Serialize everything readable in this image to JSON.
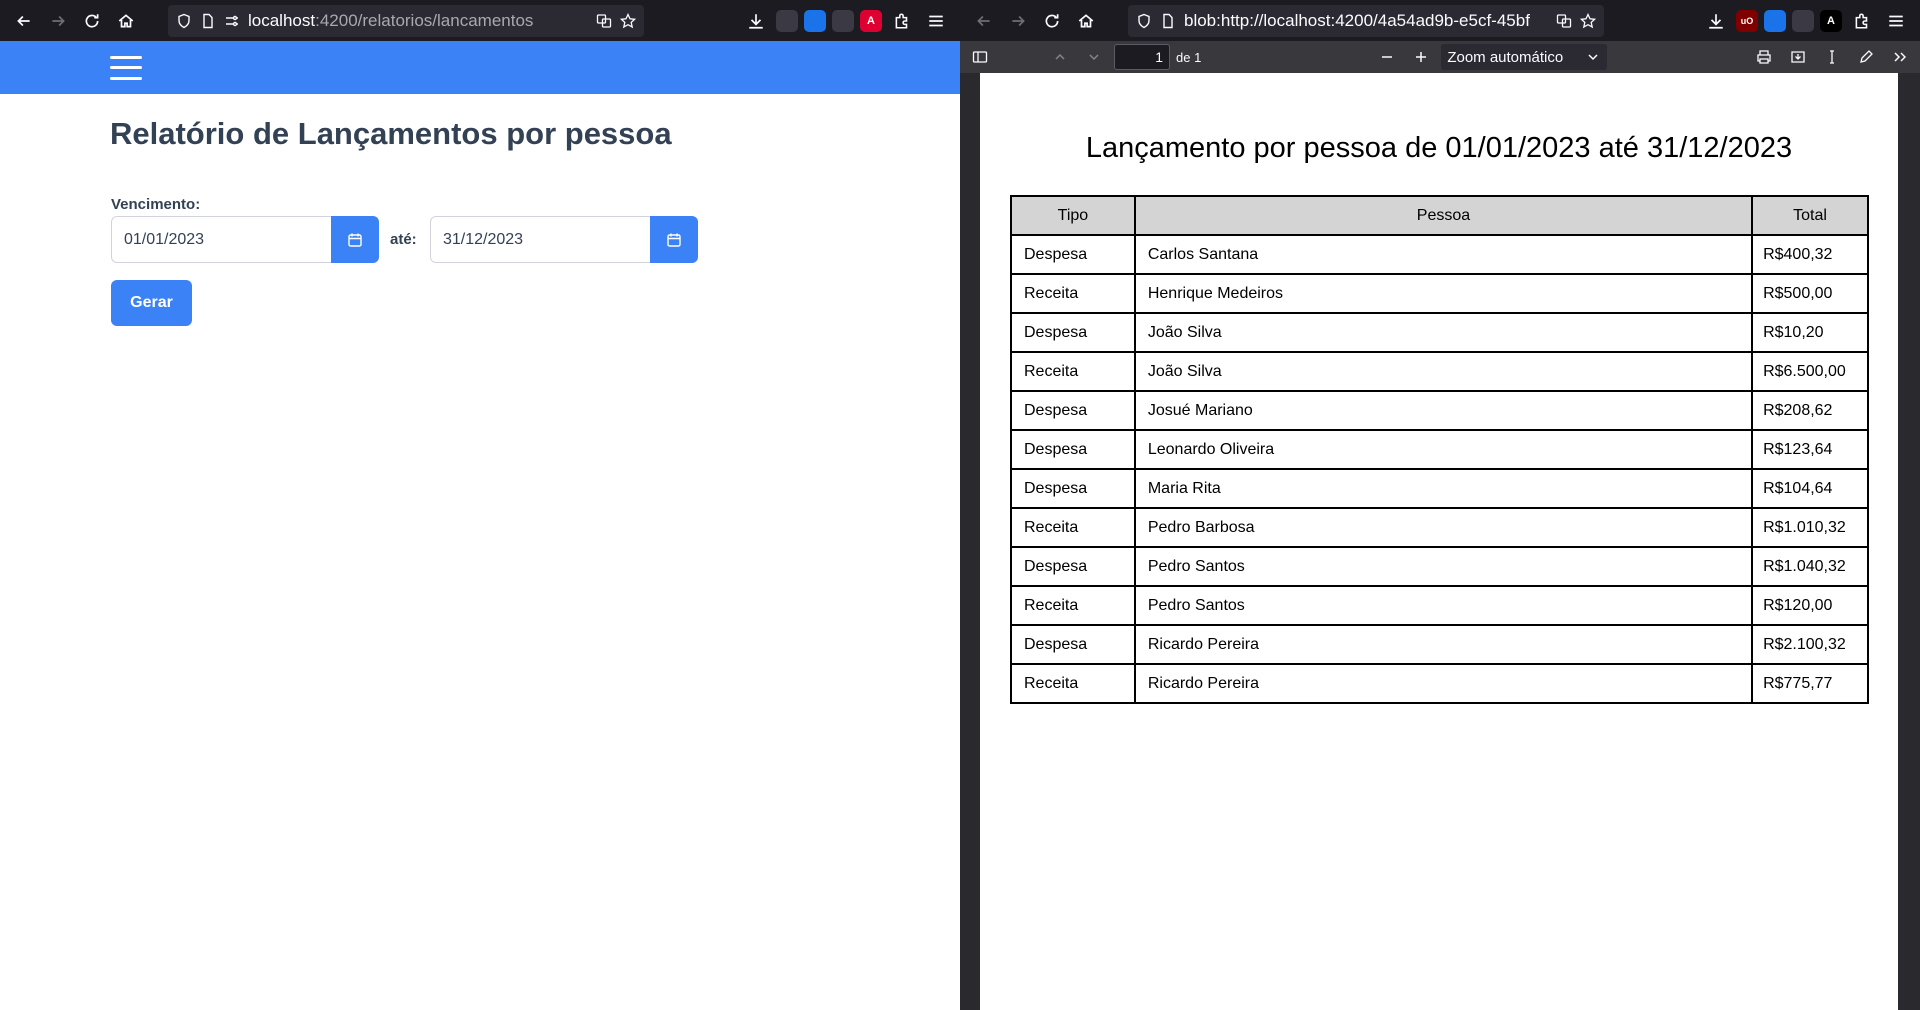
{
  "left_window": {
    "url_host": "localhost",
    "url_rest": ":4200/relatorios/lancamentos",
    "page_title": "Relatório de Lançamentos por pessoa",
    "vencimento_label": "Vencimento:",
    "ate_label": "até:",
    "date_from": "01/01/2023",
    "date_to": "31/12/2023",
    "generate_button": "Gerar"
  },
  "right_window": {
    "url": "blob:http://localhost:4200/4a54ad9b-e5cf-45bf",
    "page_number": "1",
    "page_total": "de 1",
    "zoom": "Zoom automático",
    "pdf_title": "Lançamento por pessoa de 01/01/2023 até 31/12/2023",
    "table": {
      "headers": [
        "Tipo",
        "Pessoa",
        "Total"
      ],
      "rows": [
        [
          "Despesa",
          "Carlos Santana",
          "R$400,32"
        ],
        [
          "Receita",
          "Henrique Medeiros",
          "R$500,00"
        ],
        [
          "Despesa",
          "João Silva",
          "R$10,20"
        ],
        [
          "Receita",
          "João Silva",
          "R$6.500,00"
        ],
        [
          "Despesa",
          "Josué Mariano",
          "R$208,62"
        ],
        [
          "Despesa",
          "Leonardo Oliveira",
          "R$123,64"
        ],
        [
          "Despesa",
          "Maria Rita",
          "R$104,64"
        ],
        [
          "Receita",
          "Pedro Barbosa",
          "R$1.010,32"
        ],
        [
          "Despesa",
          "Pedro Santos",
          "R$1.040,32"
        ],
        [
          "Receita",
          "Pedro Santos",
          "R$120,00"
        ],
        [
          "Despesa",
          "Ricardo Pereira",
          "R$2.100,32"
        ],
        [
          "Receita",
          "Ricardo Pereira",
          "R$775,77"
        ]
      ]
    }
  },
  "extensions": {
    "angular_badge": "A",
    "a_badge": "A",
    "ublock_badge": "uO"
  },
  "colors": {
    "accent": "#3b82f6",
    "browser_chrome": "#1c1b22"
  }
}
